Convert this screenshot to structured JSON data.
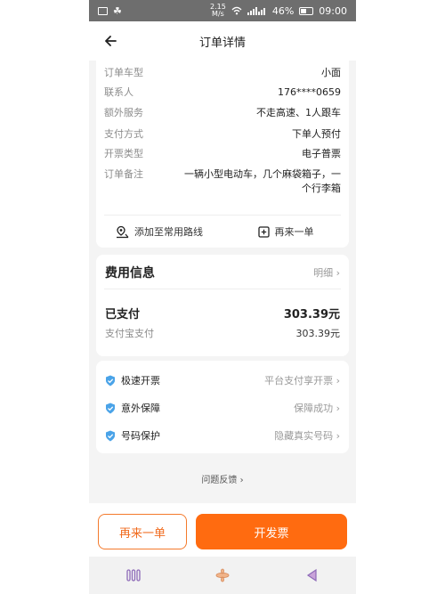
{
  "status_bar": {
    "network_speed_value": "2.15",
    "network_speed_unit": "M/s",
    "battery": "46%",
    "time": "09:00"
  },
  "header": {
    "title": "订单详情"
  },
  "order_info": {
    "rows": [
      {
        "label": "订单车型",
        "value": "小面"
      },
      {
        "label": "联系人",
        "value": "176****0659"
      },
      {
        "label": "额外服务",
        "value": "不走高速、1人跟车"
      },
      {
        "label": "支付方式",
        "value": "下单人预付"
      },
      {
        "label": "开票类型",
        "value": "电子普票"
      },
      {
        "label": "订单备注",
        "value": "一辆小型电动车，几个麻袋箱子，一个行李箱"
      }
    ],
    "add_route_label": "添加至常用路线",
    "reorder_label": "再来一单"
  },
  "fee": {
    "title": "费用信息",
    "detail_link": "明细",
    "paid_label": "已支付",
    "paid_amount": "303.39元",
    "alipay_label": "支付宝支付",
    "alipay_amount": "303.39元"
  },
  "services": [
    {
      "name": "极速开票",
      "status": "平台支付享开票"
    },
    {
      "name": "意外保障",
      "status": "保障成功"
    },
    {
      "name": "号码保护",
      "status": "隐藏真实号码"
    }
  ],
  "feedback_label": "问题反馈",
  "bottom_bar": {
    "reorder_button": "再来一单",
    "invoice_button": "开发票"
  },
  "colors": {
    "accent": "#ff6b10",
    "accent_border": "#f47a2c"
  }
}
